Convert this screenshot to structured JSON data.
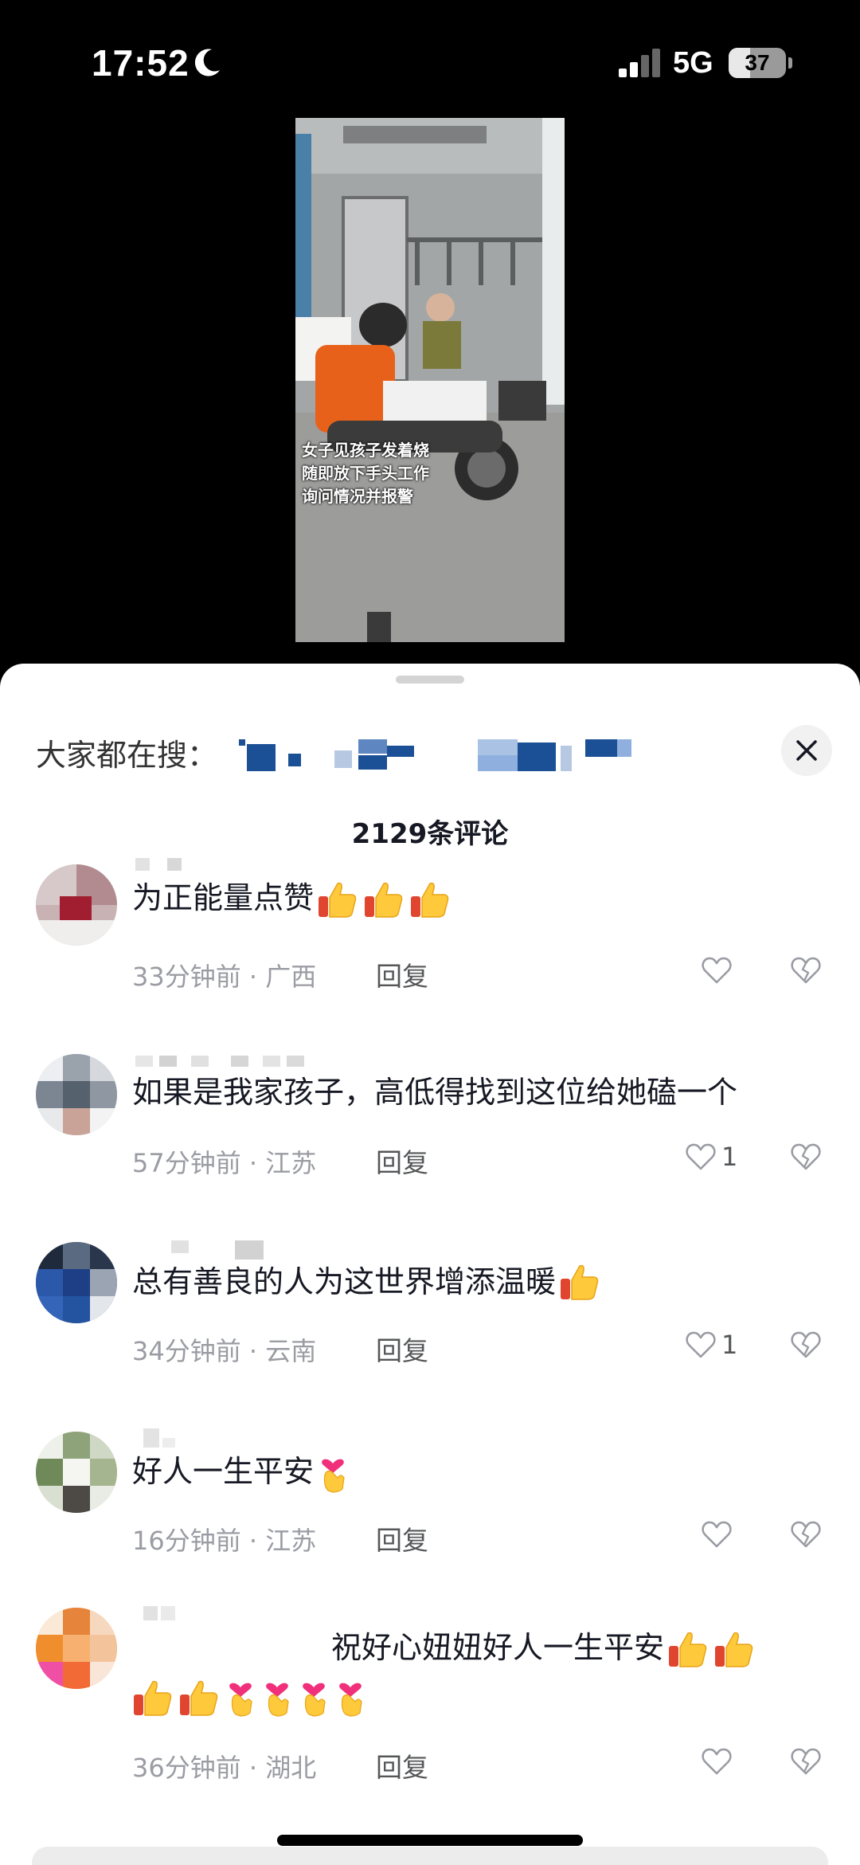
{
  "status_bar": {
    "time": "17:52",
    "network": "5G",
    "battery": "37"
  },
  "video": {
    "caption_lines": [
      "女子见孩子发着烧",
      "随即放下手头工作",
      "询问情况并报警"
    ]
  },
  "sheet": {
    "search_label": "大家都在搜：",
    "comment_count": "2129条评论"
  },
  "comments": [
    {
      "text": "为正能量点赞",
      "emojis": [
        "thumbs-up",
        "thumbs-up",
        "thumbs-up"
      ],
      "time": "33分钟前",
      "location": "广西",
      "reply": "回复",
      "likes": ""
    },
    {
      "text": "如果是我家孩子，高低得找到这位给她磕一个",
      "emojis": [],
      "time": "57分钟前",
      "location": "江苏",
      "reply": "回复",
      "likes": "1"
    },
    {
      "text": "总有善良的人为这世界增添温暖",
      "emojis": [
        "thumbs-up"
      ],
      "time": "34分钟前",
      "location": "云南",
      "reply": "回复",
      "likes": "1"
    },
    {
      "text": "好人一生平安",
      "emojis": [
        "finger-heart"
      ],
      "time": "16分钟前",
      "location": "江苏",
      "reply": "回复",
      "likes": ""
    },
    {
      "text": "祝好心妞妞好人一生平安",
      "emojis": [
        "thumbs-up",
        "thumbs-up",
        "thumbs-up",
        "thumbs-up",
        "finger-heart",
        "finger-heart",
        "finger-heart",
        "finger-heart"
      ],
      "time": "36分钟前",
      "location": "湖北",
      "reply": "回复",
      "likes": ""
    }
  ],
  "meta_separator": " · ",
  "colors": {
    "text_primary": "#161823",
    "text_meta": "#9a9ca3",
    "sheet_bg": "#ffffff"
  }
}
